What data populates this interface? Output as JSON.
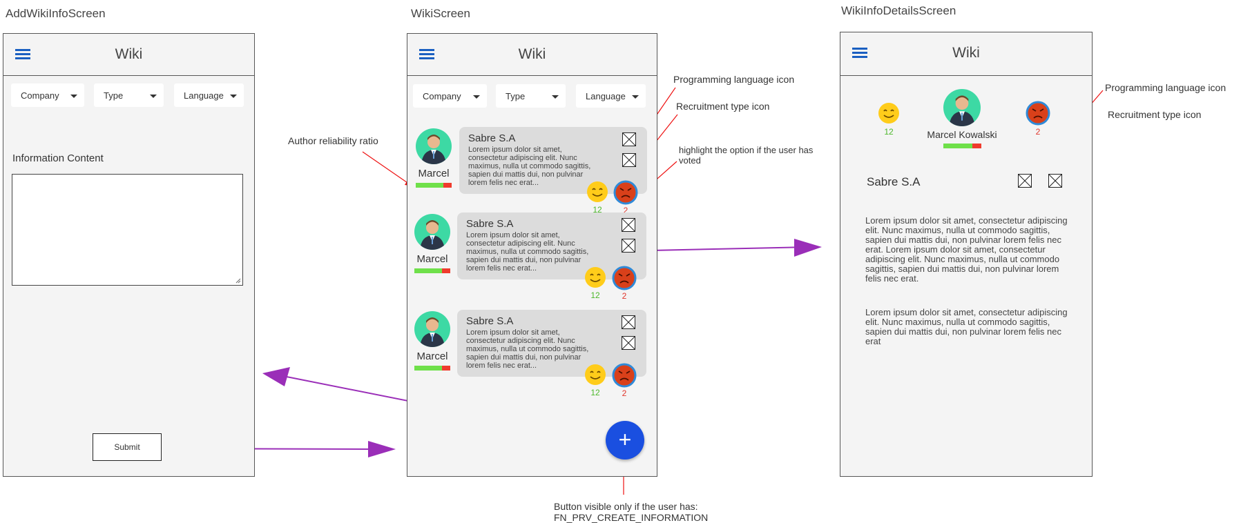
{
  "screens": {
    "add": "AddWikiInfoScreen",
    "list": "WikiScreen",
    "details": "WikiInfoDetailsScreen"
  },
  "appbar_title": "Wiki",
  "filters": {
    "company": "Company",
    "type": "Type",
    "language": "Language"
  },
  "add_screen": {
    "content_label": "Information Content",
    "submit_label": "Submit"
  },
  "cards": [
    {
      "company": "Sabre S.A",
      "author": "Marcel",
      "text": "Lorem ipsum dolor sit amet, consectetur adipiscing elit. Nunc maximus, nulla ut commodo sagittis, sapien dui mattis dui, non pulvinar lorem felis nec erat...",
      "likes": "12",
      "dislikes": "2"
    },
    {
      "company": "Sabre S.A",
      "author": "Marcel",
      "text": "Lorem ipsum dolor sit amet, consectetur adipiscing elit. Nunc maximus, nulla ut commodo sagittis, sapien dui mattis dui, non pulvinar lorem felis nec erat...",
      "likes": "12",
      "dislikes": "2"
    },
    {
      "company": "Sabre S.A",
      "author": "Marcel",
      "text": "Lorem ipsum dolor sit amet, consectetur adipiscing elit. Nunc maximus, nulla ut commodo sagittis, sapien dui mattis dui, non pulvinar lorem felis nec erat...",
      "likes": "12",
      "dislikes": "2"
    }
  ],
  "fab_label": "+",
  "details": {
    "author": "Marcel Kowalski",
    "company": "Sabre S.A",
    "likes": "12",
    "dislikes": "2",
    "paragraph1": "Lorem ipsum dolor sit amet, consectetur adipiscing elit. Nunc maximus, nulla ut commodo sagittis, sapien dui mattis dui, non pulvinar lorem felis nec erat. Lorem ipsum dolor sit amet, consectetur adipiscing elit. Nunc maximus, nulla ut commodo sagittis, sapien dui mattis dui, non pulvinar lorem felis nec erat.",
    "paragraph2": "Lorem ipsum dolor sit amet, consectetur adipiscing elit. Nunc maximus, nulla ut commodo sagittis, sapien dui mattis dui, non pulvinar lorem felis nec erat"
  },
  "annotations": {
    "programming_language_icon": "Programming language icon",
    "recruitment_type_icon": "Recruitment type icon",
    "author_reliability_ratio": "Author reliability ratio",
    "highlight_vote": "highlight the option if the user has voted",
    "fab_note_line1": "Button visible only if the user has:",
    "fab_note_line2": "FN_PRV_CREATE_INFORMATION"
  },
  "colors": {
    "accent_blue": "#1a5fc1",
    "fab_blue": "#1a4fe0",
    "arrow_purple": "#9a2eb8",
    "arrow_red": "#ee1111",
    "good_green": "#4cb82a",
    "bad_red": "#e0342a"
  }
}
